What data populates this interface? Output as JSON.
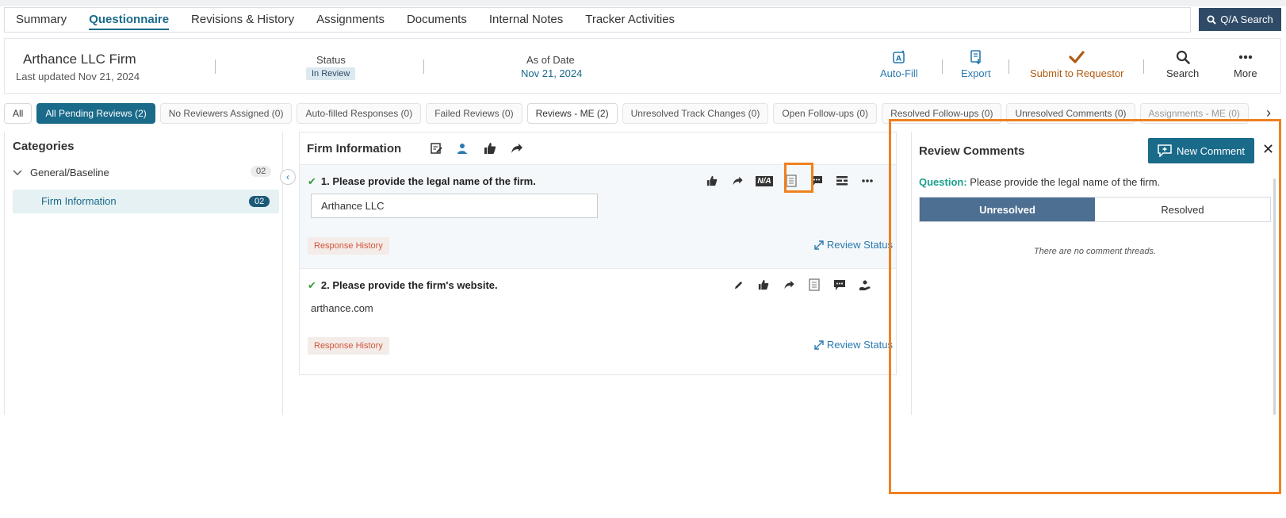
{
  "tabs": [
    "Summary",
    "Questionnaire",
    "Revisions & History",
    "Assignments",
    "Documents",
    "Internal Notes",
    "Tracker Activities"
  ],
  "qa_search_label": "Q/A Search",
  "header": {
    "firm_name": "Arthance LLC Firm",
    "last_updated": "Last updated Nov 21, 2024",
    "status_label": "Status",
    "status_value": "In Review",
    "asof_label": "As of Date",
    "asof_value": "Nov 21, 2024",
    "actions": {
      "autofill": "Auto-Fill",
      "export": "Export",
      "submit": "Submit to Requestor",
      "search": "Search",
      "more": "More"
    }
  },
  "filters": [
    "All",
    "All Pending Reviews (2)",
    "No Reviewers Assigned (0)",
    "Auto-filled Responses (0)",
    "Failed Reviews (0)",
    "Reviews - ME (2)",
    "Unresolved Track Changes (0)",
    "Open Follow-ups (0)",
    "Resolved Follow-ups (0)",
    "Unresolved Comments (0)",
    "Assignments - ME (0)"
  ],
  "categories": {
    "title": "Categories",
    "group_label": "General/Baseline",
    "group_count": "02",
    "item_label": "Firm Information",
    "item_count": "02"
  },
  "section": {
    "title": "Firm Information",
    "questions": [
      {
        "text": "1.  Please provide the legal name of the firm.",
        "answer": "Arthance LLC",
        "na": "N/A",
        "history": "Response History",
        "review": "Review Status"
      },
      {
        "text": "2.  Please provide the firm's website.",
        "answer": "arthance.com",
        "history": "Response History",
        "review": "Review Status"
      }
    ]
  },
  "comments": {
    "title": "Review Comments",
    "new_label": "New Comment",
    "question_prefix": "Question:",
    "question_text": "Please provide the legal name of the firm.",
    "unresolved": "Unresolved",
    "resolved": "Resolved",
    "empty": "There are no comment threads."
  },
  "colors": {
    "primary": "#1a6a8a",
    "highlight": "#f08020",
    "submit": "#b05a10",
    "success": "#3a9a3a"
  }
}
